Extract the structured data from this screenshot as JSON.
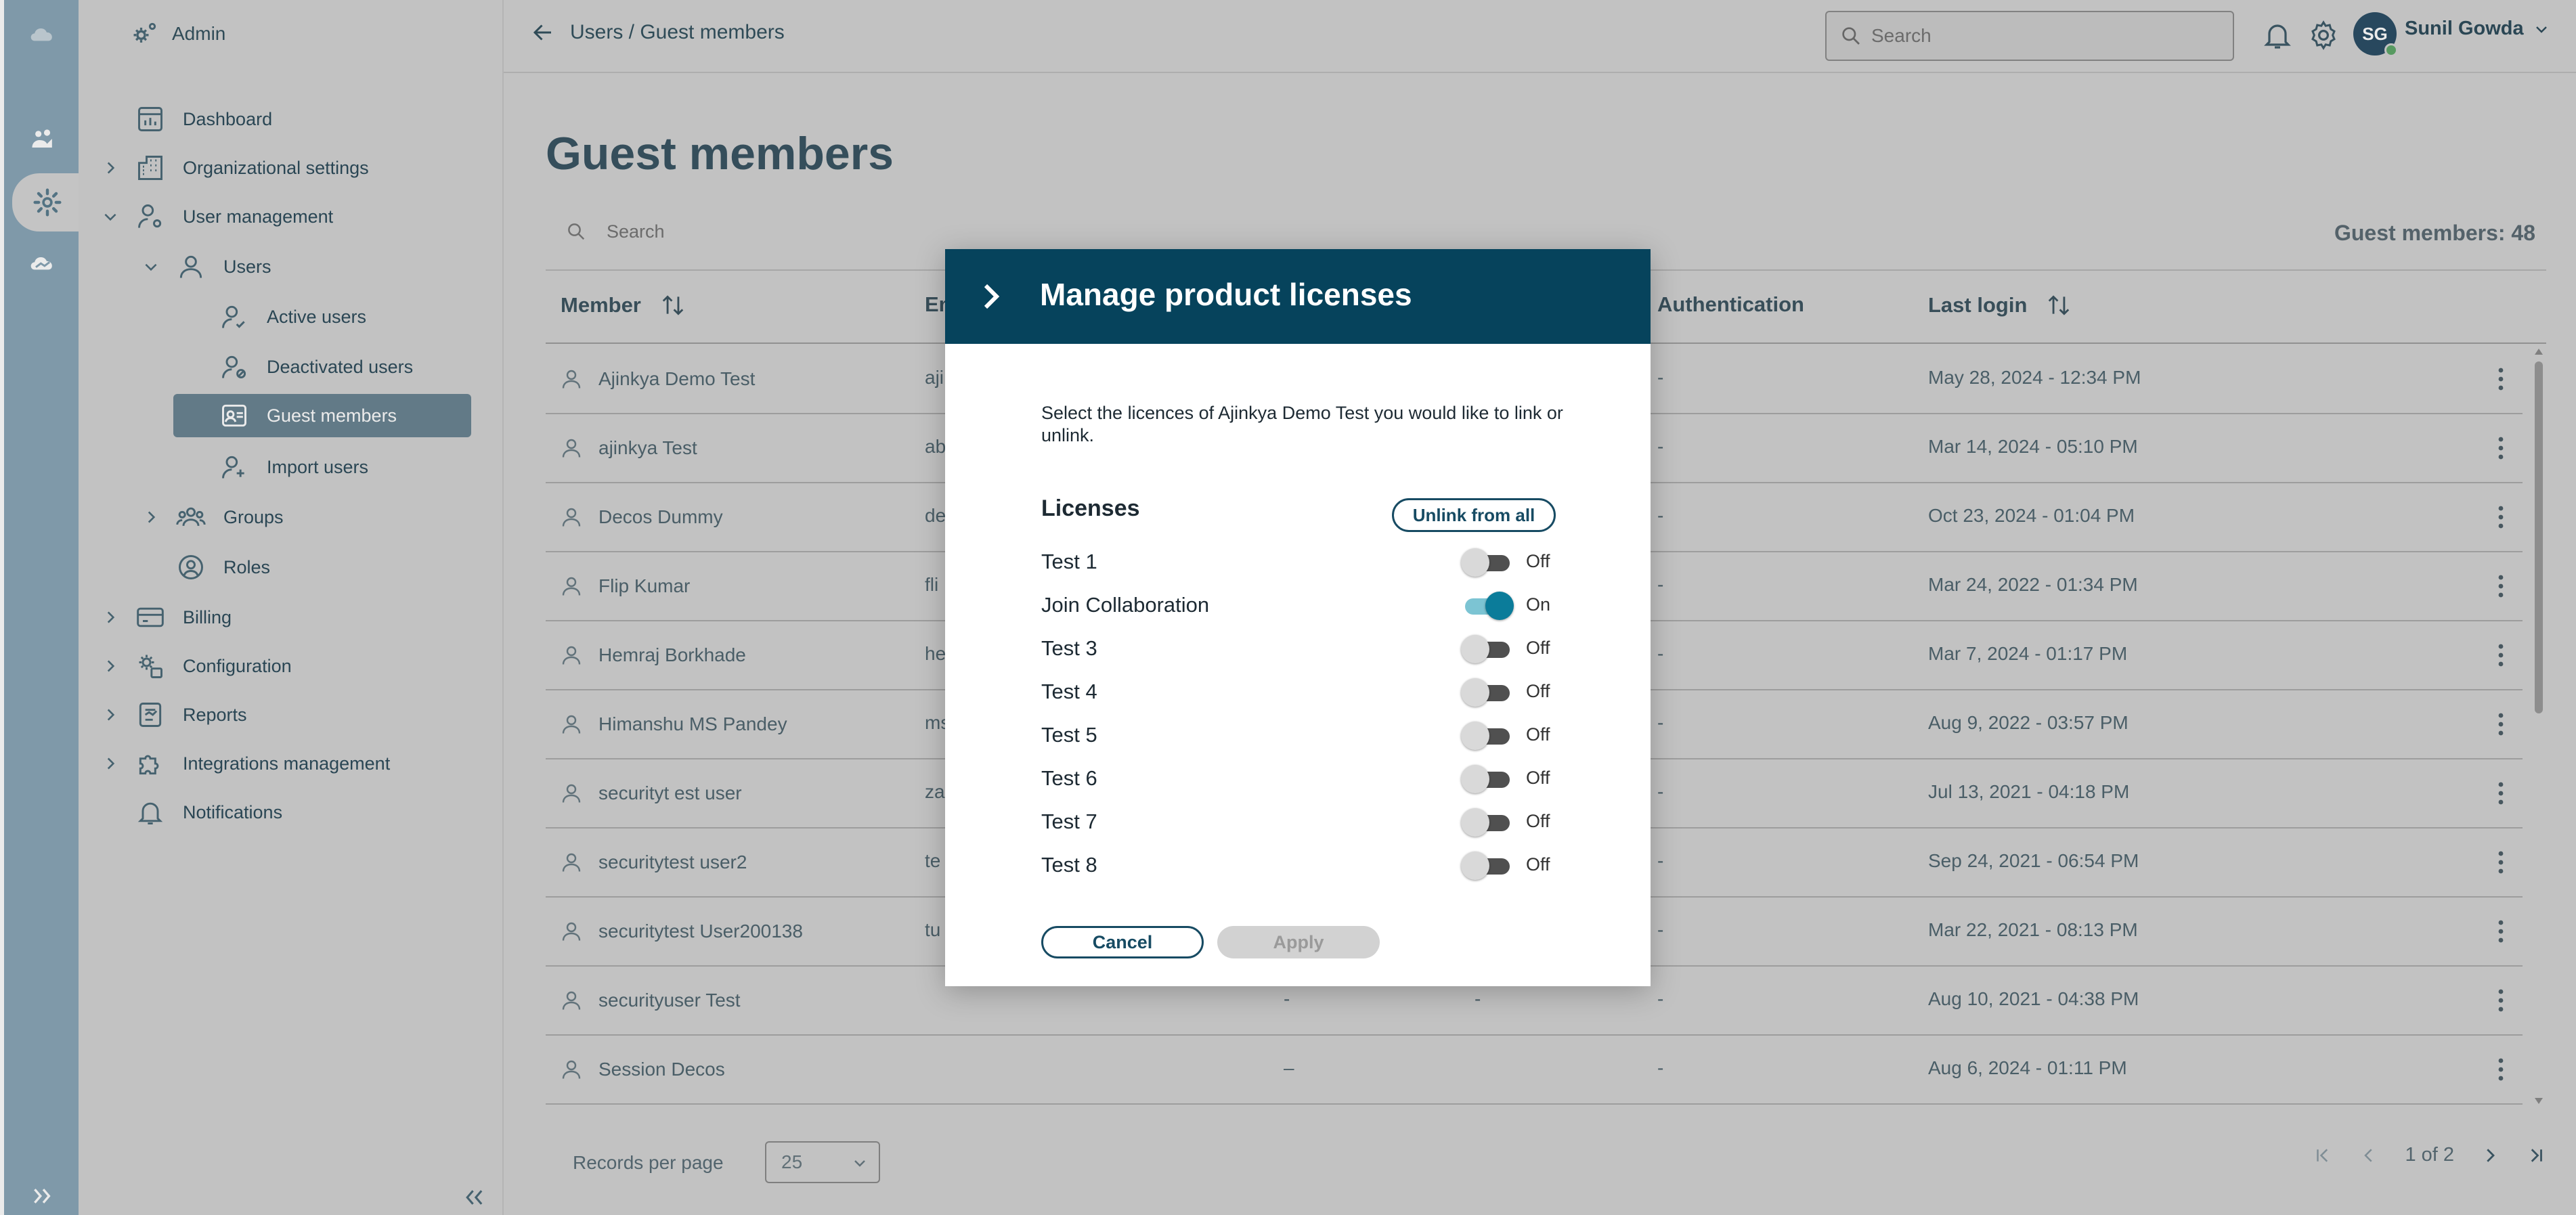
{
  "rail": {
    "items": [
      {
        "icon": "cloud-icon"
      },
      {
        "icon": "collaboration-icon"
      },
      {
        "icon": "admin-gear-icon"
      },
      {
        "icon": "cloud-alt-icon"
      }
    ]
  },
  "sidebar": {
    "brand": "Admin",
    "items": [
      {
        "label": "Dashboard"
      },
      {
        "label": "Organizational settings"
      },
      {
        "label": "User management"
      },
      {
        "label": "Users"
      },
      {
        "label": "Active users"
      },
      {
        "label": "Deactivated users"
      },
      {
        "label": "Guest members"
      },
      {
        "label": "Import users"
      },
      {
        "label": "Groups"
      },
      {
        "label": "Roles"
      },
      {
        "label": "Billing"
      },
      {
        "label": "Configuration"
      },
      {
        "label": "Reports"
      },
      {
        "label": "Integrations management"
      },
      {
        "label": "Notifications"
      }
    ]
  },
  "topbar": {
    "breadcrumb": "Users / Guest members",
    "search_placeholder": "Search",
    "avatar_initials": "SG",
    "user_name": "Sunil Gowda"
  },
  "main": {
    "title": "Guest members",
    "search_placeholder": "Search",
    "count_text": "Guest members: 48",
    "columns": {
      "member": "Member",
      "email": "Em",
      "authentication": "Authentication",
      "last_login": "Last login"
    },
    "rows": [
      {
        "member": "Ajinkya Demo Test",
        "email": "aji",
        "auth": "-",
        "last_login": "May 28, 2024 - 12:34 PM"
      },
      {
        "member": "ajinkya Test",
        "email": "ab",
        "auth": "-",
        "last_login": "Mar 14, 2024 - 05:10 PM"
      },
      {
        "member": "Decos Dummy",
        "email": "de",
        "auth": "-",
        "last_login": "Oct 23, 2024 - 01:04 PM"
      },
      {
        "member": "Flip  Kumar",
        "email": "fli",
        "auth": "-",
        "last_login": "Mar 24, 2022 - 01:34 PM"
      },
      {
        "member": "Hemraj Borkhade",
        "email": "he",
        "auth": "-",
        "last_login": "Mar 7, 2024 - 01:17 PM"
      },
      {
        "member": "Himanshu MS Pandey",
        "email": "ms",
        "auth": "-",
        "last_login": "Aug 9, 2022 - 03:57 PM"
      },
      {
        "member": "securityt est user",
        "email": "za",
        "auth": "-",
        "last_login": "Jul 13, 2021 - 04:18 PM"
      },
      {
        "member": "securitytest user2",
        "email": "te",
        "auth": "-",
        "last_login": "Sep 24, 2021 - 06:54 PM"
      },
      {
        "member": "securitytest User200138",
        "email": "tu",
        "auth": "-",
        "last_login": "Mar 22, 2021 - 08:13 PM"
      },
      {
        "member": "securityuser Test",
        "email": "",
        "col3": "-",
        "col4": "-",
        "auth": "-",
        "last_login": "Aug 10, 2021 - 04:38 PM"
      },
      {
        "member": "Session Decos",
        "email": "",
        "col3": "–",
        "col4": "",
        "auth": "-",
        "last_login": "Aug 6, 2024 - 01:11 PM"
      }
    ],
    "footer": {
      "records_label": "Records per page",
      "records_value": "25",
      "page_text": "1 of 2"
    }
  },
  "modal": {
    "title": "Manage product licenses",
    "description": "Select the licences of Ajinkya Demo Test you would like to link or unlink.",
    "licenses_heading": "Licenses",
    "unlink_label": "Unlink from all",
    "licenses": [
      {
        "name": "Test 1",
        "state": "Off",
        "on": false
      },
      {
        "name": "Join Collaboration",
        "state": "On",
        "on": true
      },
      {
        "name": "Test 3",
        "state": "Off",
        "on": false
      },
      {
        "name": "Test 4",
        "state": "Off",
        "on": false
      },
      {
        "name": "Test 5",
        "state": "Off",
        "on": false
      },
      {
        "name": "Test 6",
        "state": "Off",
        "on": false
      },
      {
        "name": "Test 7",
        "state": "Off",
        "on": false
      },
      {
        "name": "Test 8",
        "state": "Off",
        "on": false
      }
    ],
    "cancel_label": "Cancel",
    "apply_label": "Apply"
  },
  "colors": {
    "rail": "#8aa7b8",
    "sidebar": "#d3d3d3",
    "selected_nav": "#6b8593",
    "modal_header": "#06435c",
    "toggle_on": "#0b7c9a"
  }
}
